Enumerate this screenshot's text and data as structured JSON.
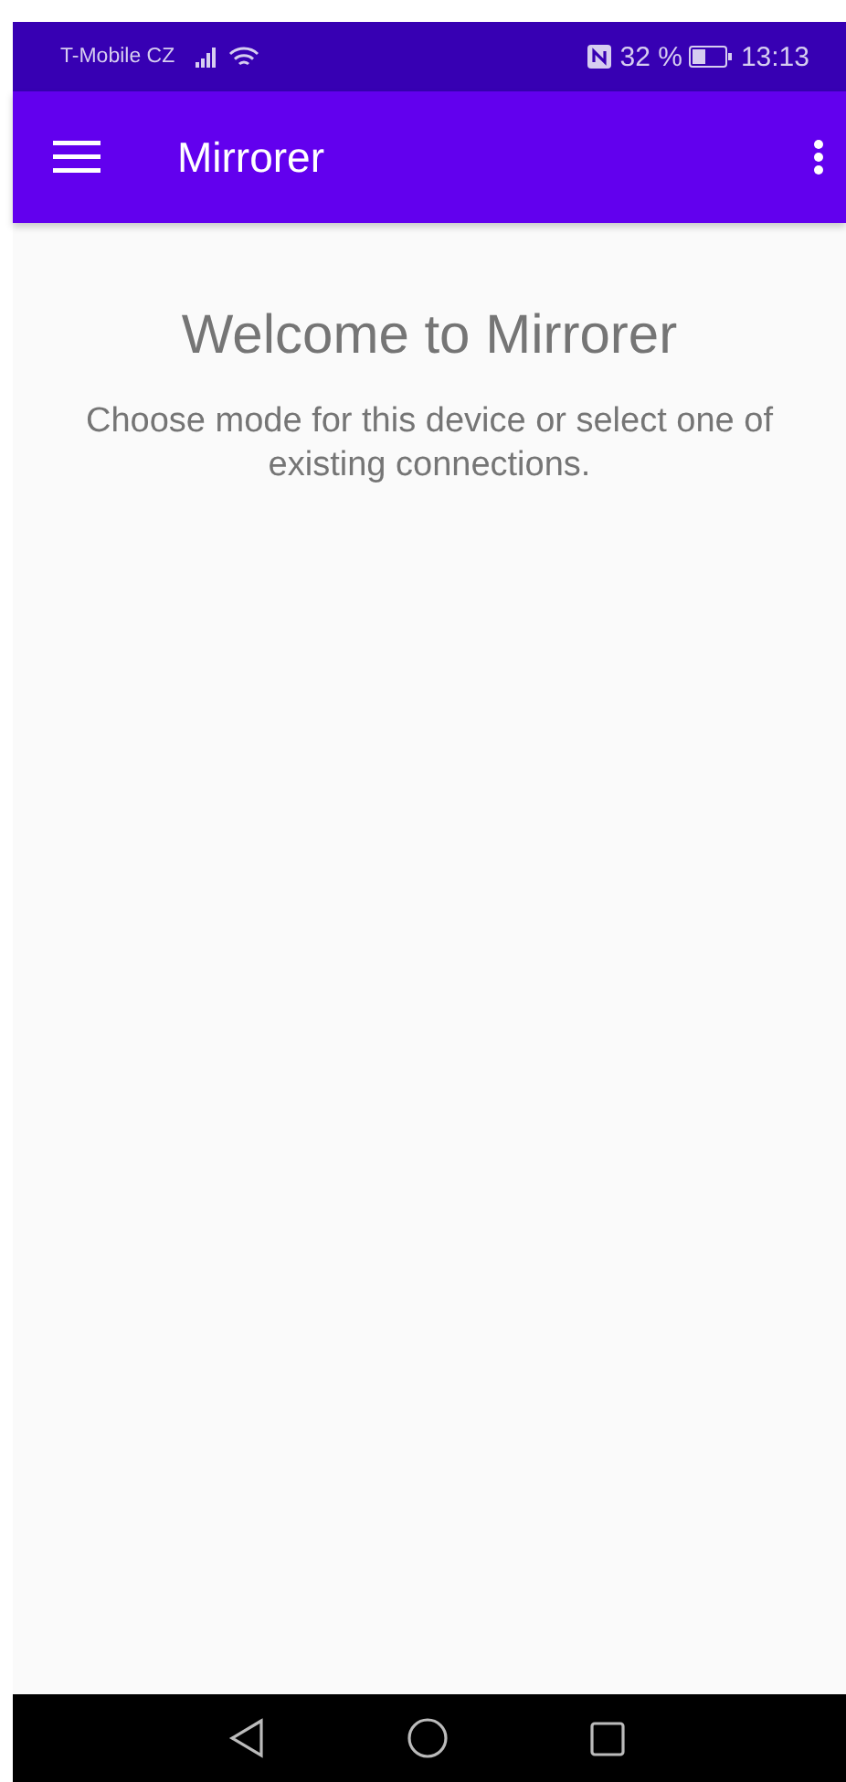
{
  "status_bar": {
    "carrier": "T-Mobile CZ",
    "battery_percent": "32 %",
    "time": "13:13"
  },
  "app_bar": {
    "title": "Mirrorer"
  },
  "content": {
    "heading": "Welcome to Mirrorer",
    "message": "Choose mode for this device or select one of existing connections."
  }
}
